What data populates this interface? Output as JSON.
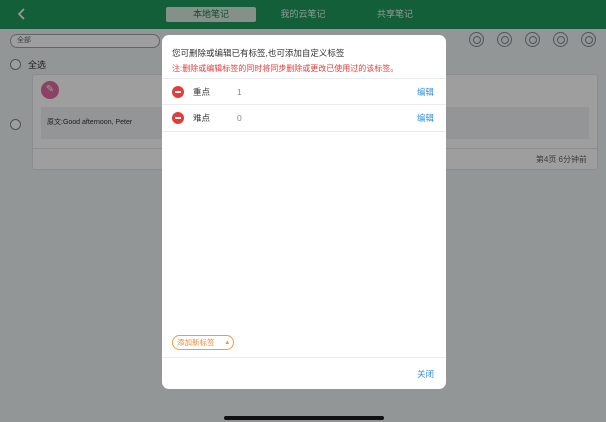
{
  "header": {
    "back_icon": "chevron-left-icon",
    "tabs": [
      {
        "label": "本地笔记",
        "active": true
      },
      {
        "label": "我的云笔记",
        "active": false
      },
      {
        "label": "共享笔记",
        "active": false
      }
    ],
    "accent": "#1f9a5e"
  },
  "toolbar": {
    "filter_value": "全部",
    "icons": [
      "search-icon",
      "filter-icon",
      "refresh-icon",
      "upload-icon",
      "delete-icon"
    ]
  },
  "list": {
    "select_all_label": "全选",
    "note": {
      "icon": "pen-icon",
      "content": "原文:Good afternoon, Peter",
      "footer": "第4页 6分钟前"
    }
  },
  "modal": {
    "title": "您可删除或编辑已有标签,也可添加自定义标签",
    "warning": "注:删除或编辑标签的同时将同步删除或更改已使用过的该标签。",
    "tags": [
      {
        "name": "重点",
        "count": "1",
        "edit_label": "编辑"
      },
      {
        "name": "难点",
        "count": "0",
        "edit_label": "编辑"
      }
    ],
    "add_tag_label": "添加新标签",
    "close_label": "关闭",
    "warning_color": "#e23c3c",
    "link_color": "#2e8fe0"
  }
}
